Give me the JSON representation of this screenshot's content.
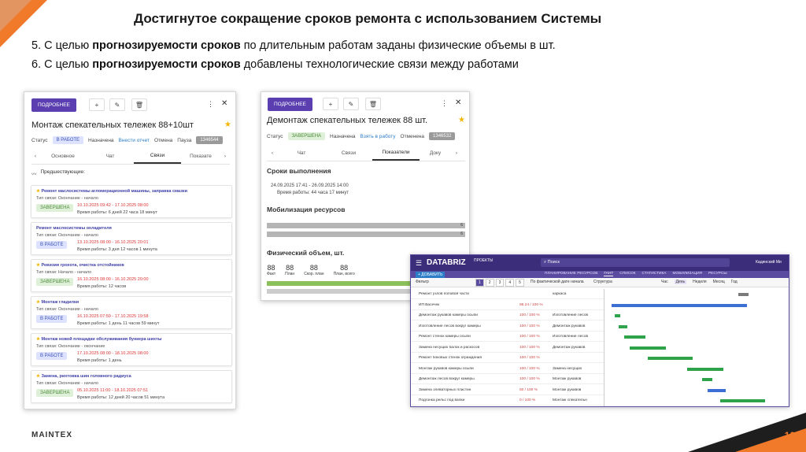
{
  "slide": {
    "title": "Достигнутое сокращение сроков ремонта с использованием Системы",
    "line1_pre": "5. С целью ",
    "line1_bold": "прогнозируемости сроков",
    "line1_post": " по длительным работам заданы физические объемы в шт.",
    "line2_pre": "6. С целью ",
    "line2_bold": "прогнозируемости сроков",
    "line2_post": " добавлены технологические связи между работами",
    "page_number": "16",
    "logo_text": "MAINTEX",
    "accent_color": "#f07a2a"
  },
  "panel1": {
    "more_button": "ПОДРОБНЕЕ",
    "title": "Монтаж спекательных тележек 88+10шт",
    "status_label": "Статус",
    "status_chip": "В РАБОТЕ",
    "statuses": [
      "Назначена",
      "Внести отчет",
      "Отмена",
      "Пауза"
    ],
    "id_badge": "1346544",
    "tabs": [
      "Основное",
      "Чат",
      "Связи",
      "Показате"
    ],
    "predecessors_label": "Предшествующие:",
    "cards": [
      {
        "name": "Ремонт маслосистемы агломерационной машины, заправка смазки",
        "link": "Тип связи: Окончание - начало",
        "status": "ЗАВЕРШЕНА",
        "dates": "10.10.2025 09:42 - 17.10.2025 08:00",
        "time": "Время работы: 6 дней 22 часа 18 минут",
        "starred": true
      },
      {
        "name": "Ремонт маслосистемы охладителя",
        "link": "Тип связи: Окончание - начало",
        "status": "В РАБОТЕ",
        "dates": "13.10.2025 08:00 - 16.10.2025 20:01",
        "time": "Время работы: 3 дня 12 часов 1 минута",
        "starred": false
      },
      {
        "name": "Ревизия грохота, очистка отстойников",
        "link": "Тип связи: Начало - начало",
        "status": "ЗАВЕРШЕНА",
        "dates": "16.10.2025 08:00 - 16.10.2025 20:00",
        "time": "Время работы: 12 часов",
        "starred": true
      },
      {
        "name": "Монтаж гладилки",
        "link": "Тип связи: Окончание - начало",
        "status": "В РАБОТЕ",
        "dates": "16.10.2025 07:59 - 17.10.2025 19:58",
        "time": "Время работы: 1 день 11 часов 59 минут",
        "starred": true
      },
      {
        "name": "Монтаж новой площадки обслуживания бункера шихты",
        "link": "Тип связи: Окончание - окончание",
        "status": "В РАБОТЕ",
        "dates": "17.10.2025 08:00 - 18.10.2025 08:00",
        "time": "Время работы: 1 день",
        "starred": true
      },
      {
        "name": "Замена, рихтовка шин головного радиуса",
        "link": "Тип связи: Окончание - начало",
        "status": "ЗАВЕРШЕНА",
        "dates": "05.10.2025 11:00 - 18.10.2025 07:51",
        "time": "Время работы: 12 дней 20 часов 51 минута",
        "starred": true
      }
    ]
  },
  "panel2": {
    "more_button": "ПОДРОБНЕЕ",
    "title": "Демонтаж спекательных тележек 88 шт.",
    "status_label": "Статус",
    "status_chip": "ЗАВЕРШЕНА",
    "statuses": [
      "Назначена",
      "Взять в работу",
      "Отменена"
    ],
    "id_badge": "1346532",
    "tabs": [
      "Чат",
      "Связи",
      "Показатели",
      "Доку"
    ],
    "deadlines_title": "Сроки выполнения",
    "deadline_dates": "24.09.2025 17:41 - 26.09.2025 14:00",
    "deadline_time": "Время работы: 44 часа 17 минут",
    "mobilization_title": "Мобилизация ресурсов",
    "mobilization_values": [
      "6",
      "6"
    ],
    "volume_title": "Физический объем, шт.",
    "volume_stats": [
      {
        "value": "88",
        "label": "Факт"
      },
      {
        "value": "88",
        "label": "План"
      },
      {
        "value": "88",
        "label": "Скор. план"
      },
      {
        "value": "88",
        "label": "План, всего"
      }
    ],
    "volume_progress": 1.0
  },
  "gantt": {
    "brand": "DATABRIZ",
    "project_label": "ПРОЕКТЫ",
    "search_placeholder": "Поиск",
    "add_button": "+ ДОБАВИТЬ",
    "nav_tabs": [
      "ПЛАНИРОВАНИЕ РЕСУРСОВ",
      "ГАНТ",
      "СПИСОК",
      "СТАТИСТИКА",
      "МОБИЛИЗАЦИЯ",
      "РЕСУРСЫ"
    ],
    "active_tab": "ГАНТ",
    "filter_label": "Фильтр",
    "sort_label": "По фактической дате начала",
    "structure_label": "Структура",
    "scale_labels": [
      "Час",
      "День",
      "Неделя",
      "Месяц",
      "Год"
    ],
    "user_name": "Кадинский Ми",
    "rows": [
      {
        "name": "Ремонт узлов поповой части",
        "pct": "",
        "res": "каркаса"
      },
      {
        "name": "ИП Васечек",
        "pct": "96.24 / 100 %",
        "res": ""
      },
      {
        "name": "Демонтаж рукавов камеры осыпи",
        "pct": "100 / 100 %",
        "res": "Изготовление лесов"
      },
      {
        "name": "Изготовление лесов вокруг камеры",
        "pct": "100 / 100 %",
        "res": "Демонтаж рукавов"
      },
      {
        "name": "Ремонт стенок камеры осыпи",
        "pct": "100 / 100 %",
        "res": "Изготовление лесов"
      },
      {
        "name": "Замена несущих балок и раскосов",
        "pct": "100 / 100 %",
        "res": "Демонтаж рукавов"
      },
      {
        "name": "Ремонт боковых стенок ограждения",
        "pct": "100 / 100 %",
        "res": ""
      },
      {
        "name": "Монтаж рукавов камеры осыпи",
        "pct": "100 / 100 %",
        "res": "Замена несущих"
      },
      {
        "name": "Демонтаж лесов вокруг камеры",
        "pct": "100 / 100 %",
        "res": "Монтаж рукавов"
      },
      {
        "name": "Замена элеваторных пластин",
        "pct": "50 / 100 %",
        "res": "Монтаж рукавов"
      },
      {
        "name": "Подгонка рельс под валки",
        "pct": "0 / 100 %",
        "res": "Монтаж спекательн"
      }
    ]
  }
}
